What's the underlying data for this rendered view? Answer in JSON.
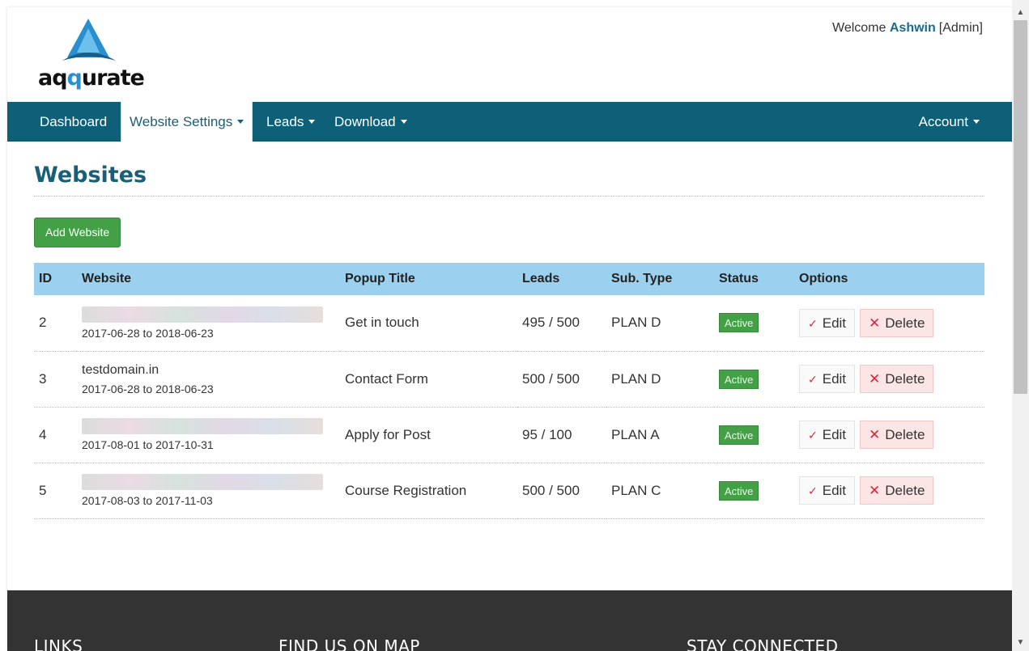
{
  "header": {
    "logo_text_a": "aq",
    "logo_text_b": "q",
    "logo_text_c": "urate",
    "welcome_prefix": "Welcome",
    "user_name": "Ashwin",
    "user_role": "[Admin]"
  },
  "nav": {
    "items": [
      {
        "label": "Dashboard"
      },
      {
        "label": "Website Settings"
      },
      {
        "label": "Leads"
      },
      {
        "label": "Download"
      }
    ],
    "account_label": "Account"
  },
  "page": {
    "title": "Websites",
    "add_button": "Add Website"
  },
  "table": {
    "headers": [
      "ID",
      "Website",
      "Popup Title",
      "Leads",
      "Sub. Type",
      "Status",
      "Options"
    ],
    "rows": [
      {
        "id": "2",
        "website": "",
        "dates": "2017-06-28 to 2018-06-23",
        "popup_title": "Get in touch",
        "leads": "495 / 500",
        "sub_type": "PLAN D",
        "status": "Active"
      },
      {
        "id": "3",
        "website": "testdomain.in",
        "dates": "2017-06-28 to 2018-06-23",
        "popup_title": "Contact Form",
        "leads": "500 / 500",
        "sub_type": "PLAN D",
        "status": "Active"
      },
      {
        "id": "4",
        "website": "",
        "dates": "2017-08-01 to 2017-10-31",
        "popup_title": "Apply for Post",
        "leads": "95 / 100",
        "sub_type": "PLAN A",
        "status": "Active"
      },
      {
        "id": "5",
        "website": "",
        "dates": "2017-08-03 to 2017-11-03",
        "popup_title": "Course Registration",
        "leads": "500 / 500",
        "sub_type": "PLAN C",
        "status": "Active"
      }
    ],
    "edit_label": "Edit",
    "delete_label": "Delete"
  },
  "footer": {
    "links_heading": "LINKS",
    "map_heading": "FIND US ON MAP",
    "connected_heading": "STAY CONNECTED"
  },
  "colors": {
    "navbar": "#0d6078",
    "table_header": "#9bd0ee",
    "success": "#43a047",
    "danger": "#d7263d",
    "footer": "#333333"
  }
}
